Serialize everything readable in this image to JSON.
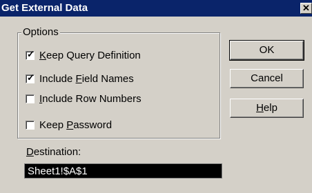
{
  "window": {
    "title": "Get External Data",
    "close_glyph": "✕"
  },
  "options": {
    "label": "Options",
    "items": [
      {
        "pre": "",
        "mnemonic": "K",
        "post": "eep Query Definition",
        "checked": true
      },
      {
        "pre": "Include ",
        "mnemonic": "F",
        "post": "ield Names",
        "checked": true
      },
      {
        "pre": "",
        "mnemonic": "I",
        "post": "nclude Row Numbers",
        "checked": false
      },
      {
        "pre": "Keep ",
        "mnemonic": "P",
        "post": "assword",
        "checked": false
      }
    ]
  },
  "buttons": {
    "ok": "OK",
    "cancel": "Cancel",
    "help_mnemonic": "H",
    "help_rest": "elp"
  },
  "destination": {
    "label_mnemonic": "D",
    "label_rest": "estination:",
    "value": "Sheet1!$A$1"
  },
  "icons": {
    "close": "close-icon",
    "check": "checkmark-icon"
  }
}
